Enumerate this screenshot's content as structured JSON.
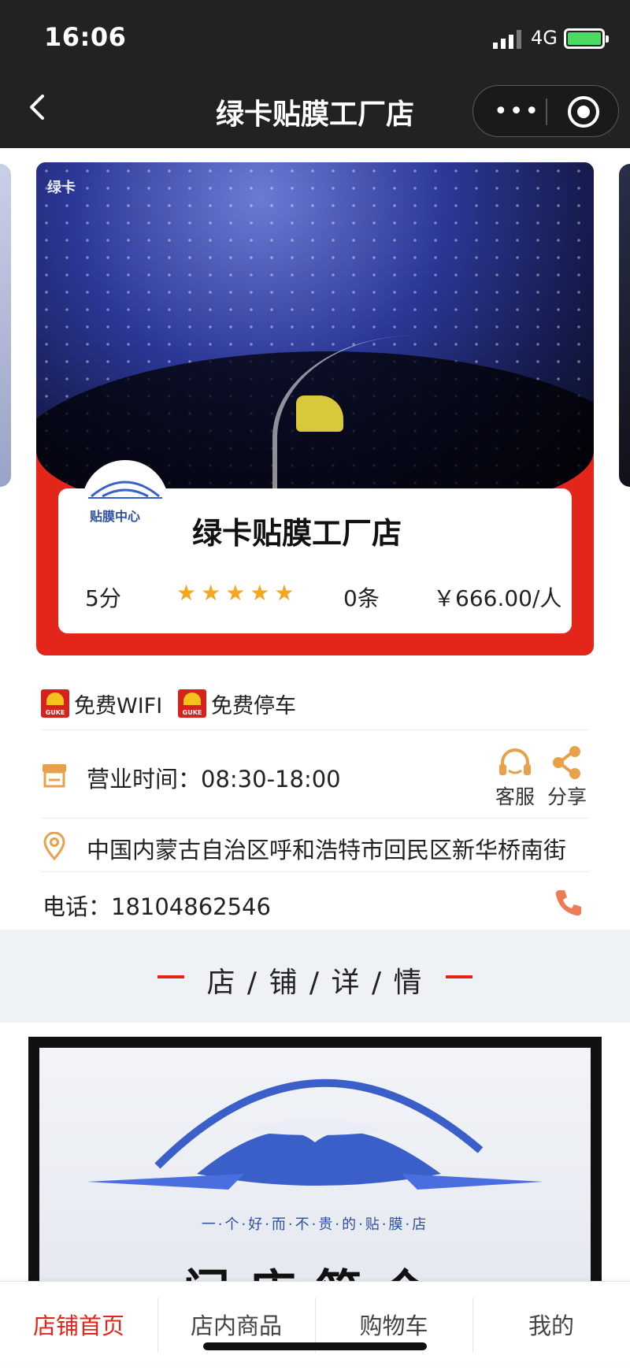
{
  "status_bar": {
    "time": "16:06",
    "network": "4G"
  },
  "nav": {
    "title": "绿卡贴膜工厂店"
  },
  "banner": {
    "watermark": "绿卡",
    "logo_text": "贴膜中心",
    "shop_name": "绿卡贴膜工厂店",
    "score": "5分",
    "rating": 5,
    "stars": "★★★★★",
    "review_count": "0条",
    "price": "￥666.00/人"
  },
  "features": [
    {
      "icon": "guke-logo-icon",
      "icon_text": "GUKE",
      "label": "免费WIFI"
    },
    {
      "icon": "guke-logo-icon",
      "icon_text": "GUKE",
      "label": "免费停车"
    }
  ],
  "hours": {
    "label": "营业时间：08:30-18:00"
  },
  "actions": {
    "service_label": "客服",
    "share_label": "分享"
  },
  "address": {
    "text": "中国内蒙古自治区呼和浩特市回民区新华桥南街"
  },
  "phone": {
    "label": "电话：18104862546"
  },
  "section": {
    "title": "店 / 铺 / 详 / 情"
  },
  "detail": {
    "slogan": "一·个·好·而·不·贵·的·贴·膜·店",
    "heading": "门店简介"
  },
  "tabbar": [
    {
      "label": "店铺首页",
      "active": true
    },
    {
      "label": "店内商品",
      "active": false
    },
    {
      "label": "购物车",
      "active": false
    },
    {
      "label": "我的",
      "active": false
    }
  ],
  "colors": {
    "accent": "#e3251a",
    "star": "#f5a623",
    "icon_orange": "#e8a04a",
    "phone": "#f07a55"
  }
}
